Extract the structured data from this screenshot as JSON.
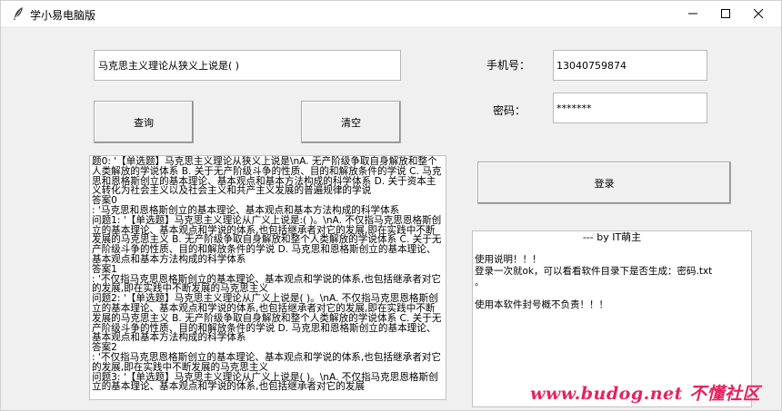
{
  "window": {
    "title": "学小易电脑版",
    "icon": "feather-icon",
    "controls": {
      "minimize": "minimize-icon",
      "maximize": "maximize-icon",
      "close": "close-icon"
    }
  },
  "query": {
    "question_value": "马克思主义理论从狭义上说是( )",
    "search_label": "查询",
    "clear_label": "清空"
  },
  "login": {
    "phone_label": "手机号：",
    "phone_value": "13040759874",
    "password_label": "密码：",
    "password_value": "*******",
    "login_label": "登录"
  },
  "results": {
    "lines": [
      "题0: '【单选题】马克思主义理论从狭义上说是\\nA. 无产阶级争取自身解放和整个人类解放的学说体系 B. 关于无产阶级斗争的性质、目的和解放条件的学说 C. 马克思和恩格斯创立的基本理论、基本观点和基本方法构成的科学体系 D. 关于资本主 义转化为社会主义以及社会主义和共产主义发展的普遍规律的学说",
      "答案0",
      ": '马克思和恩格斯创立的基本理论、基本观点和基本方法构成的科学体系",
      "问题1: '【单选题】马克思主义理论从广义上说是:( )。\\nA. 不仅指马克思恩格斯创立的基本理论、基本观点和学说的体系,也包括继承者对它的发展,即在实践中不断发展的马克思主义 B. 无产阶级争取自身解放和整个人类解放的学说体系 C. 关于无产阶级斗争的性质、目的和解放条件的学说 D. 马克思和恩格斯创立的基本理论、基本观点和基本方法构成的科学体系",
      "答案1",
      ": '不仅指马克思恩格斯创立的基本理论、基本观点和学说的体系,也包括继承者对它的发展,即在实践中不断发展的马克思主义",
      "问题2: '【单选题】马克思主义理论从广义上说是( )。\\nA. 不仅指马克思恩格斯创立的基本理论、基本观点和学说的体系,也包括继承者对它的发展,即在实践中不断发展的马克思主义 B. 无产阶级争取自身解放和整个人类解放的学说体系 C. 关于无产阶级斗争的性质、目的和解放条件的学说 D. 马克思和恩格斯创立的基本理论、基本观点和基本方法构成的科学体系",
      "答案2",
      ": '不仅指马克思恩格斯创立的基本理论、基本观点和学说的体系,也包括继承者对它的发展,即在实践中不断发展的马克思主义",
      "问题3: '【单选题】马克思主义理论从广义上说是( )。\\nA. 不仅指马克思恩格斯创立的基本理论、基本观点和学说的体系,也包括继承者对它的发展"
    ]
  },
  "info": {
    "byline": "--- by IT萌主",
    "lines": [
      "使用说明！！！",
      "登录一次就ok，可以看看软件目录下是否生成：密码.txt",
      "。",
      "",
      "使用本软件封号概不负责！！！"
    ]
  },
  "watermark": {
    "text": "www.budog.net 不懂社区",
    "color": "#e5225f"
  }
}
